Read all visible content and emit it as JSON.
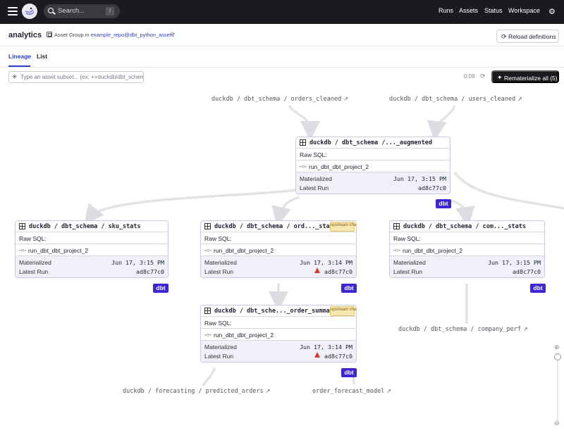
{
  "topbar": {
    "search_placeholder": "Search...",
    "search_shortcut": "/",
    "nav": [
      "Runs",
      "Assets",
      "Status",
      "Workspace"
    ],
    "icons": {
      "menu": "menu-icon",
      "logo": "dagster-logo",
      "settings": "gear-icon"
    }
  },
  "header": {
    "title": "analytics",
    "group_label": "Asset Group in",
    "group_link": "example_repo@dbt_python_assets",
    "reload_label": "Reload definitions"
  },
  "tabs": [
    "Lineage",
    "List"
  ],
  "toolbar": {
    "filter_placeholder": "Type an asset subset... (ex: ++duckdb/dbt_schema/orders_cleaned++)",
    "timer": "0:08",
    "rematerialize_label": "Rematerialize all (5)"
  },
  "external_assets": {
    "orders_cleaned": "duckdb / dbt_schema / orders_cleaned",
    "users_cleaned": "duckdb / dbt_schema / users_cleaned",
    "company_perf": "duckdb / dbt_schema / company_perf",
    "predicted_orders": "duckdb / forecasting / predicted_orders",
    "order_forecast_model": "order_forecast_model"
  },
  "nodes": {
    "augmented": {
      "name": "duckdb / dbt_schema /..._augmented",
      "raw_sql": "Raw SQL:",
      "op": "run_dbt_dbt_project_2",
      "materialized_label": "Materialized",
      "materialized": "Jun 17, 3:15 PM",
      "latest_run_label": "Latest Run",
      "latest_run": "ad8c77c0",
      "tag": "dbt"
    },
    "sku_stats": {
      "name": "duckdb / dbt_schema / sku_stats",
      "raw_sql": "Raw SQL:",
      "op": "run_dbt_dbt_project_2",
      "materialized_label": "Materialized",
      "materialized": "Jun 17, 3:15 PM",
      "latest_run_label": "Latest Run",
      "latest_run": "ad8c77c0",
      "tag": "dbt"
    },
    "order_stats": {
      "name": "duckdb / dbt_schema / ord..._stats",
      "badge": "upstream changed",
      "raw_sql": "Raw SQL:",
      "op": "run_dbt_dbt_project_2",
      "materialized_label": "Materialized",
      "materialized": "Jun 17, 3:14 PM",
      "latest_run_label": "Latest Run",
      "latest_run": "ad8c77c0",
      "tag": "dbt"
    },
    "company_stats": {
      "name": "duckdb / dbt_schema / com..._stats",
      "raw_sql": "Raw SQL:",
      "op": "run_dbt_dbt_project_2",
      "materialized_label": "Materialized",
      "materialized": "Jun 17, 3:15 PM",
      "latest_run_label": "Latest Run",
      "latest_run": "ad8c77c0",
      "tag": "dbt"
    },
    "order_summary": {
      "name": "duckdb / dbt_sche..._order_summary",
      "badge": "upstream changed",
      "raw_sql": "Raw SQL:",
      "op": "run_dbt_dbt_project_2",
      "materialized_label": "Materialized",
      "materialized": "Jun 17, 3:14 PM",
      "latest_run_label": "Latest Run",
      "latest_run": "ad8c77c0",
      "tag": "dbt"
    }
  },
  "colors": {
    "accent": "#2c3fc9",
    "dbt": "#3d26d4",
    "warning": "#d23c2b",
    "badge": "#f7e7b0"
  }
}
